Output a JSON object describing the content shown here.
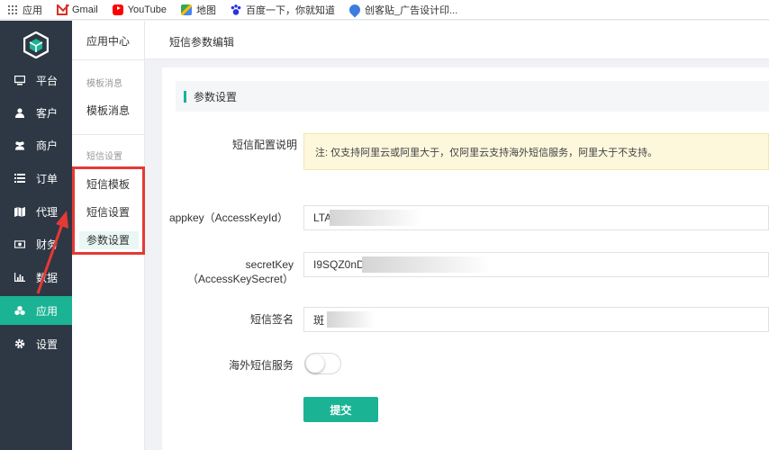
{
  "bookmarks": [
    {
      "label": "应用",
      "icon": "apps-grid-icon"
    },
    {
      "label": "Gmail",
      "icon": "gmail-icon"
    },
    {
      "label": "YouTube",
      "icon": "youtube-icon"
    },
    {
      "label": "地图",
      "icon": "maps-icon"
    },
    {
      "label": "百度一下，你就知道",
      "icon": "baidu-icon"
    },
    {
      "label": "创客贴_广告设计印...",
      "icon": "chuangkit-icon"
    }
  ],
  "sidebar": {
    "items": [
      {
        "label": "平台",
        "icon": "monitor-icon"
      },
      {
        "label": "客户",
        "icon": "user-icon"
      },
      {
        "label": "商户",
        "icon": "users-icon"
      },
      {
        "label": "订单",
        "icon": "list-icon"
      },
      {
        "label": "代理",
        "icon": "map-icon"
      },
      {
        "label": "财务",
        "icon": "money-icon"
      },
      {
        "label": "数据",
        "icon": "bar-chart-icon"
      },
      {
        "label": "应用",
        "icon": "cubes-icon",
        "active": true
      },
      {
        "label": "设置",
        "icon": "gear-icon"
      }
    ]
  },
  "submenu": {
    "title": "应用中心",
    "group1": "模板消息",
    "item_template_msg": "模板消息",
    "group2": "短信设置",
    "item_sms_template": "短信模板",
    "item_sms_settings": "短信设置",
    "item_params": "参数设置"
  },
  "header": {
    "breadcrumb": "短信参数编辑"
  },
  "form": {
    "section_title": "参数设置",
    "notice_label": "短信配置说明",
    "notice_text": "注: 仅支持阿里云或阿里大于，仅阿里云支持海外短信服务，阿里大于不支持。",
    "appkey_label": "appkey（AccessKeyId）",
    "appkey_value": "LTA",
    "secret_label_1": "secretKey",
    "secret_label_2": "（AccessKeySecret）",
    "secret_value": "I9SQZ0nD",
    "sign_label": "短信签名",
    "sign_value": "斑",
    "overseas_label": "海外短信服务",
    "submit_label": "提交"
  },
  "colors": {
    "accent": "#1ab394",
    "sidebar_bg": "#2d3844",
    "highlight_box": "#e53935"
  }
}
